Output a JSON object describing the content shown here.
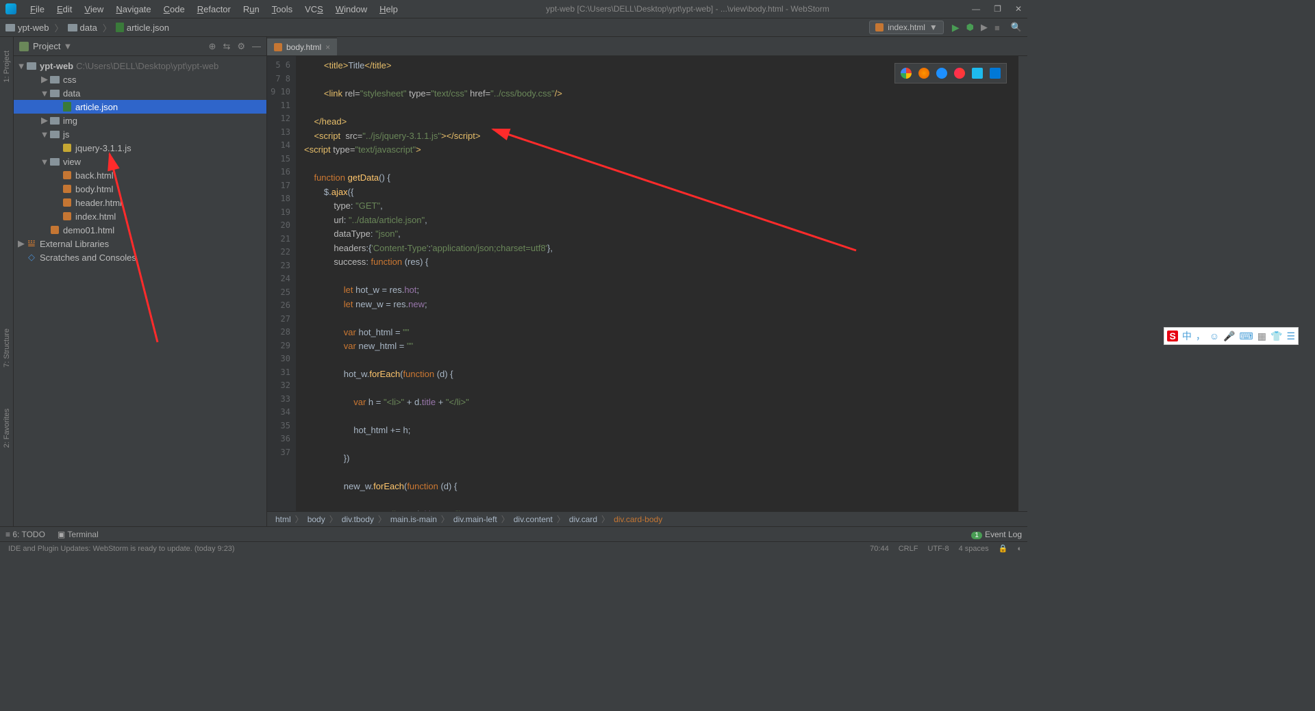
{
  "window": {
    "title": "ypt-web [C:\\Users\\DELL\\Desktop\\ypt\\ypt-web] - ...\\view\\body.html - WebStorm"
  },
  "menu": [
    "File",
    "Edit",
    "View",
    "Navigate",
    "Code",
    "Refactor",
    "Run",
    "Tools",
    "VCS",
    "Window",
    "Help"
  ],
  "breadcrumbs": {
    "root": "ypt-web",
    "mid": "data",
    "file": "article.json"
  },
  "run_config": "index.html",
  "sidebar": {
    "title": "Project",
    "tree": {
      "root": "ypt-web",
      "root_path": "C:\\Users\\DELL\\Desktop\\ypt\\ypt-web",
      "items": [
        {
          "name": "css",
          "type": "folder",
          "depth": 1,
          "arrow": "▶"
        },
        {
          "name": "data",
          "type": "folder",
          "depth": 1,
          "arrow": "▼"
        },
        {
          "name": "article.json",
          "type": "json",
          "depth": 2,
          "selected": true
        },
        {
          "name": "img",
          "type": "folder",
          "depth": 1,
          "arrow": "▶"
        },
        {
          "name": "js",
          "type": "folder",
          "depth": 1,
          "arrow": "▼"
        },
        {
          "name": "jquery-3.1.1.js",
          "type": "jsfile",
          "depth": 2
        },
        {
          "name": "view",
          "type": "folder",
          "depth": 1,
          "arrow": "▼"
        },
        {
          "name": "back.html",
          "type": "html",
          "depth": 2
        },
        {
          "name": "body.html",
          "type": "html",
          "depth": 2
        },
        {
          "name": "header.html",
          "type": "html",
          "depth": 2
        },
        {
          "name": "index.html",
          "type": "html",
          "depth": 2
        },
        {
          "name": "demo01.html",
          "type": "html",
          "depth": 1
        }
      ],
      "ext_lib": "External Libraries",
      "scratches": "Scratches and Consoles"
    }
  },
  "left_tabs": [
    "1: Project",
    "7: Structure",
    "2: Favorites"
  ],
  "editor_tab": "body.html",
  "gutter_start": 5,
  "gutter_end": 37,
  "crumb_path": [
    "html",
    "body",
    "div.tbody",
    "main.is-main",
    "div.main-left",
    "div.content",
    "div.card",
    "div.card-body"
  ],
  "bottom": {
    "todo": "6: TODO",
    "terminal": "Terminal",
    "event_log": "Event Log"
  },
  "status": {
    "msg": "IDE and Plugin Updates: WebStorm is ready to update. (today 9:23)",
    "pos": "70:44",
    "eol": "CRLF",
    "enc": "UTF-8",
    "indent": "4 spaces"
  },
  "ime": [
    "中",
    "，",
    "☺",
    "🎤",
    "⌨",
    "▦",
    "👕",
    "☰"
  ]
}
